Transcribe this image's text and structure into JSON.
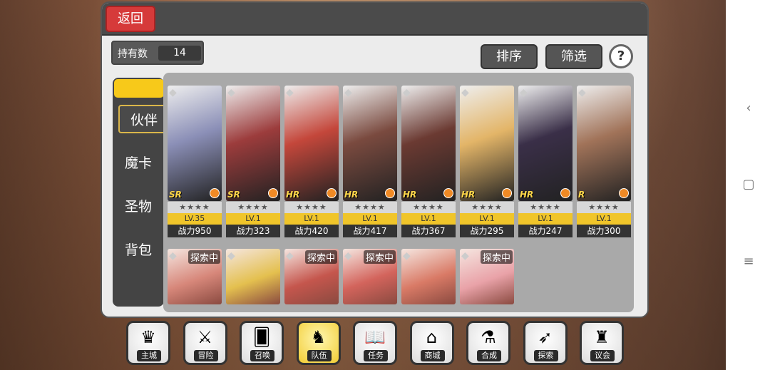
{
  "header": {
    "back_label": "返回"
  },
  "owned": {
    "label": "持有数",
    "value": "14"
  },
  "toolbar": {
    "sort_label": "排序",
    "filter_label": "筛选",
    "help_label": "?"
  },
  "sidebar": {
    "items": [
      {
        "label": "伙伴"
      },
      {
        "label": "魔卡"
      },
      {
        "label": "圣物"
      },
      {
        "label": "背包"
      }
    ]
  },
  "cards": [
    {
      "rarity": "SR",
      "stars": "★★★★",
      "level": "LV.35",
      "power": "战力950",
      "color": "#8b8fb7"
    },
    {
      "rarity": "SR",
      "stars": "★★★★",
      "level": "LV.1",
      "power": "战力323",
      "color": "#9c3c3c"
    },
    {
      "rarity": "HR",
      "stars": "★★★★",
      "level": "LV.1",
      "power": "战力420",
      "color": "#c4473b"
    },
    {
      "rarity": "HR",
      "stars": "★★★★",
      "level": "LV.1",
      "power": "战力417",
      "color": "#7a4a3f"
    },
    {
      "rarity": "HR",
      "stars": "★★★★",
      "level": "LV.1",
      "power": "战力367",
      "color": "#6b3a32"
    },
    {
      "rarity": "HR",
      "stars": "★★★★",
      "level": "LV.1",
      "power": "战力295",
      "color": "#e3b568"
    },
    {
      "rarity": "HR",
      "stars": "★★★★",
      "level": "LV.1",
      "power": "战力247",
      "color": "#3a2f48"
    },
    {
      "rarity": "R",
      "stars": "★★★★",
      "level": "LV.1",
      "power": "战力300",
      "color": "#a17359"
    }
  ],
  "cards_row2": [
    {
      "status": "探索中",
      "color": "#d7877a"
    },
    {
      "status": "",
      "color": "#e4c04f"
    },
    {
      "status": "探索中",
      "color": "#c5564d"
    },
    {
      "status": "探索中",
      "color": "#d3645c"
    },
    {
      "status": "",
      "color": "#d97a66"
    },
    {
      "status": "探索中",
      "color": "#e9a2a8"
    }
  ],
  "dock": [
    {
      "label": "主城",
      "icon": "crown-icon",
      "glyph": "♛"
    },
    {
      "label": "冒险",
      "icon": "swords-icon",
      "glyph": "⚔"
    },
    {
      "label": "召唤",
      "icon": "cards-icon",
      "glyph": "🂠"
    },
    {
      "label": "队伍",
      "icon": "wings-icon",
      "glyph": "♞"
    },
    {
      "label": "任务",
      "icon": "book-icon",
      "glyph": "📖"
    },
    {
      "label": "商城",
      "icon": "mushroom-icon",
      "glyph": "⌂"
    },
    {
      "label": "合成",
      "icon": "potion-icon",
      "glyph": "⚗"
    },
    {
      "label": "探索",
      "icon": "bow-icon",
      "glyph": "➶"
    },
    {
      "label": "议会",
      "icon": "council-icon",
      "glyph": "♜"
    }
  ]
}
